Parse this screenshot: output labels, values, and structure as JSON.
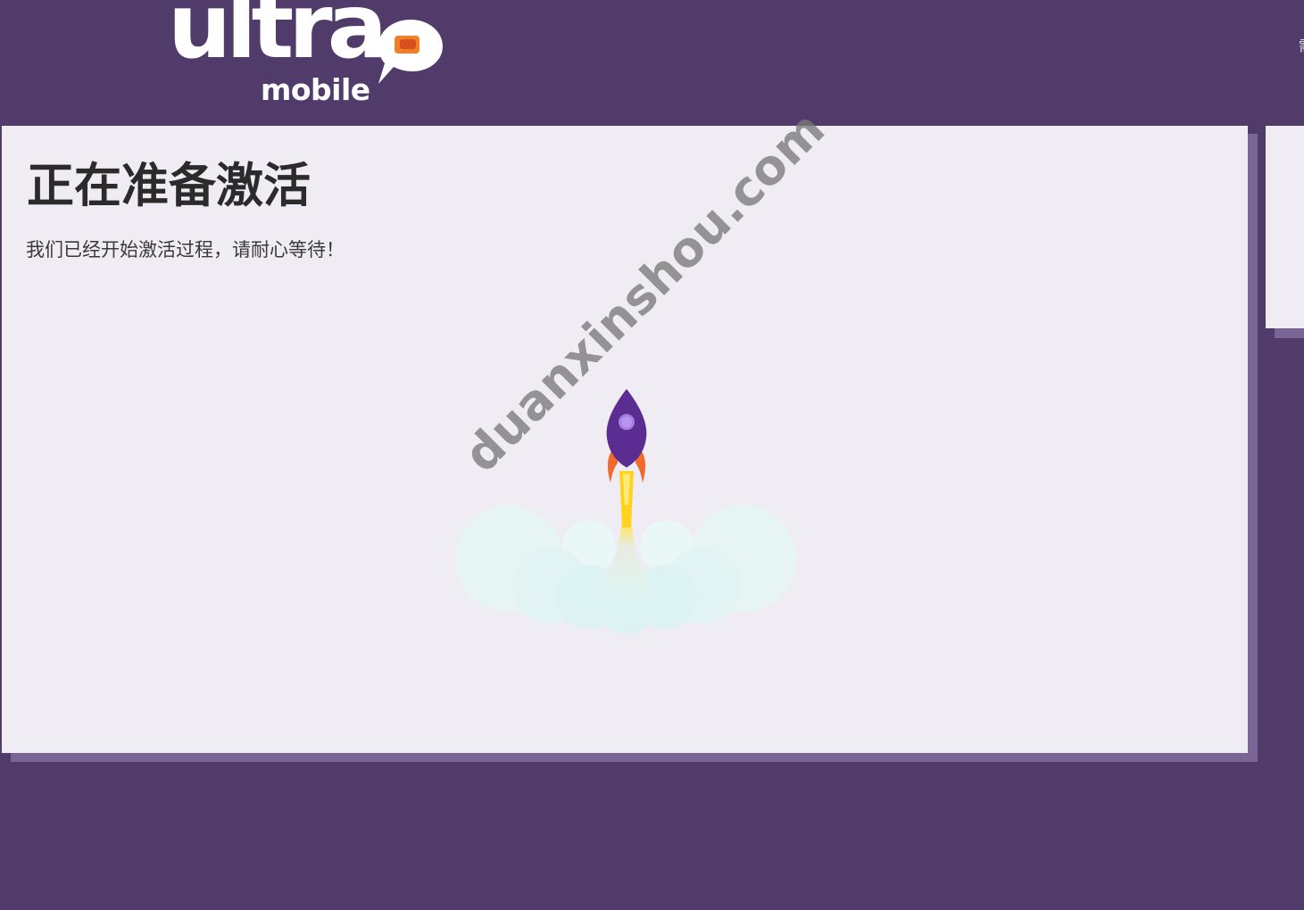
{
  "header": {
    "logo_word": "ultra",
    "logo_sub": "mobile",
    "edge_glyph": "需"
  },
  "main": {
    "title": "正在准备激活",
    "subtitle": "我们已经开始激活过程，请耐心等待！",
    "illustration_icon": "rocket-launch-icon"
  },
  "watermark": {
    "text": "duanxinshou.com"
  },
  "colors": {
    "page_background": "#513b6b",
    "card_background": "#f0ecf4",
    "card_shadow": "#7b6596",
    "rocket_body": "#5b2c91",
    "rocket_window": "#a77ee6",
    "rocket_fins": "#f26a2b",
    "flame": "#ffd21f",
    "smoke": "#e0f5f4",
    "logo_bubble": "#f07f2a"
  }
}
